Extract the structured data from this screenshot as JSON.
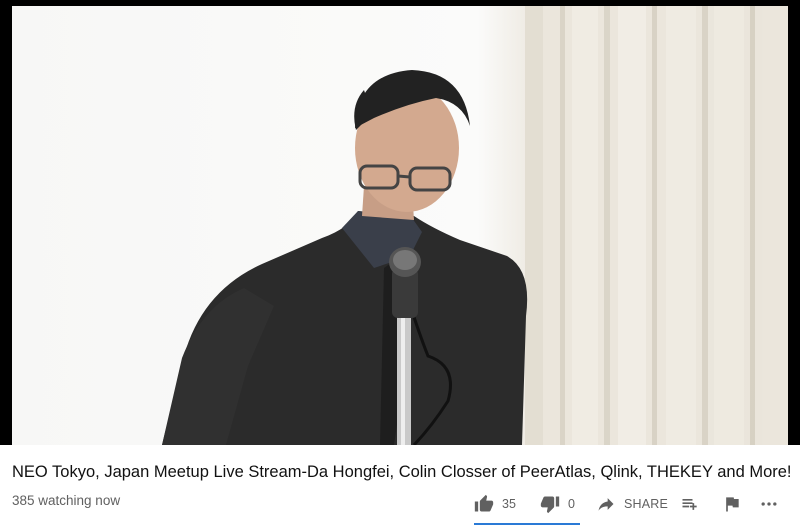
{
  "video": {
    "title": "NEO Tokyo, Japan Meetup Live Stream-Da Hongfei, Colin Closser of PeerAtlas, Qlink, THEKEY and More!",
    "viewers": "385 watching now",
    "likes": "35",
    "dislikes": "0",
    "share_label": "SHARE",
    "like_ratio": 1.0
  },
  "icons": {
    "like": "thumbs-up-icon",
    "dislike": "thumbs-down-icon",
    "share": "share-arrow-icon",
    "add": "add-to-playlist-icon",
    "flag": "flag-icon",
    "more": "more-horizontal-icon"
  },
  "colors": {
    "accent": "#2a7ad6",
    "meta_text": "#606060",
    "player_bg": "#000000"
  }
}
